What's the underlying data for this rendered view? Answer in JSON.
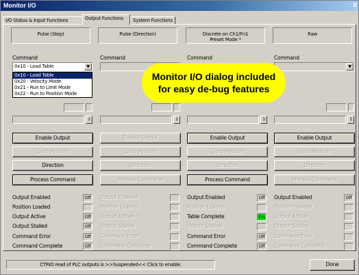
{
  "window": {
    "title": "Monitor I/O",
    "close": "x"
  },
  "tabs": [
    "I/O Status & Input Functions",
    "Output Functions",
    "System Functions"
  ],
  "columns": [
    {
      "header_line1": "Pulse (Step)",
      "header_line2": "",
      "command_label": "Command",
      "command_value": "0x10 - Load Table",
      "enabled": true
    },
    {
      "header_line1": "Pulse (Direction)",
      "header_line2": "",
      "command_label": "Command",
      "command_value": "",
      "enabled": false
    },
    {
      "header_line1": "Discrete on Ch1/Fn1",
      "header_line2": "Preset Mode *",
      "command_label": "Command",
      "command_value": "",
      "enabled": true
    },
    {
      "header_line1": "Raw",
      "header_line2": "",
      "command_label": "Command",
      "command_value": "",
      "enabled": false
    }
  ],
  "dropdown_options": [
    "0x10 - Load Table",
    "0x20 - Velocity Mode",
    "0x21 - Run to Limit Mode",
    "0x22 - Run to Position Mode"
  ],
  "buttons": {
    "enable_output": "Enable Output",
    "goto_position": "Goto Position",
    "direction": "Direction",
    "process_command": "Process Command"
  },
  "status_labels": {
    "col1": [
      "Output Enabled",
      "Position Loaded",
      "Output Active",
      "Output Stalled",
      "Command Error",
      "Command Complete"
    ],
    "col2": [
      "Output Enabled",
      "Position Loaded",
      "Output Active",
      "Output Stalled",
      "Command Error",
      "Command Complete"
    ],
    "col3": [
      "Output Enabled",
      "Position Loaded",
      "Table Complete",
      "Output Stalled",
      "Command Error",
      "Command Complete"
    ],
    "col4": [
      "Output Enabled",
      "Position Loaded",
      "Output Active",
      "Output Stalled",
      "Command Error",
      "Command Complete"
    ]
  },
  "status_values": {
    "col1": [
      "Off",
      "",
      "Off",
      "Off",
      "Off",
      "Off"
    ],
    "col2": [
      "",
      "",
      "",
      "",
      "",
      ""
    ],
    "col3": [
      "Off",
      "",
      "On",
      "",
      "Off",
      "Off"
    ],
    "col4": [
      "Off",
      "",
      "",
      "",
      "",
      ""
    ]
  },
  "spin_value": "1",
  "footer": {
    "status": "CTRIO read of PLC outputs is >>Suspended<< Click to enable.",
    "done": "Done"
  },
  "callout": {
    "line1": "Monitor I/O dialog included",
    "line2": "for easy de-bug features"
  },
  "colors": {
    "title_start": "#0a246a",
    "on": "#00e000",
    "callout": "#ffff00"
  }
}
